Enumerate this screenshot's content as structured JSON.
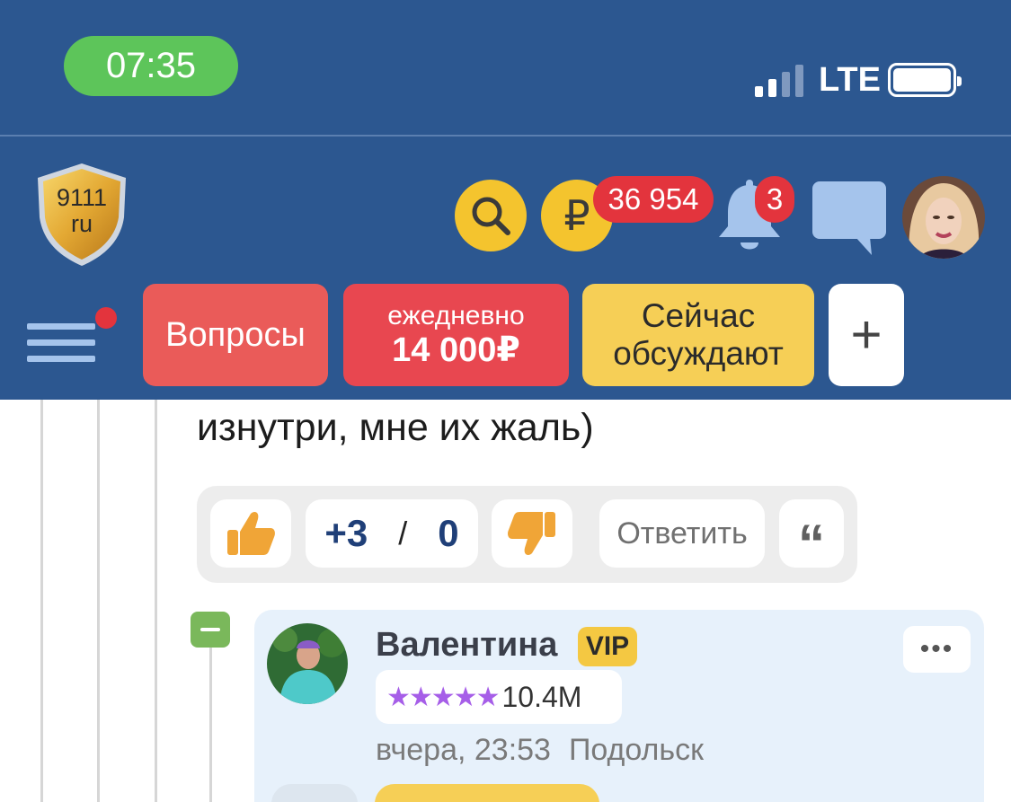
{
  "status_bar": {
    "time": "07:35",
    "network": "LTE",
    "colors": {
      "background": "#2c5790",
      "time_pill": "#5dc55a"
    }
  },
  "header": {
    "logo": {
      "line1": "9111",
      "line2": "ru"
    },
    "balance": "36 954",
    "notifications_count": "3",
    "ruble_symbol": "₽",
    "icons": [
      "search-icon",
      "ruble-icon",
      "bell-icon",
      "chat-icon",
      "user-avatar"
    ],
    "colors": {
      "background": "#2c5790",
      "accent_yellow": "#f4c42e",
      "badge_red": "#e3343d"
    }
  },
  "nav": {
    "questions_label": "Вопросы",
    "daily_line1": "ежедневно",
    "daily_line2": "14 000₽",
    "hot_line1": "Сейчас",
    "hot_line2": "обсуждают",
    "plus_label": "+",
    "menu_has_dot": true
  },
  "comment": {
    "text": "изнутри, мне их жаль)",
    "likes": "+3",
    "separator": "/",
    "dislikes": "0",
    "reply_label": "Ответить",
    "quote_symbol": "“"
  },
  "reply": {
    "author": "Валентина",
    "badge": "VIP",
    "stars": "★★★★★",
    "rating": "10.4M",
    "time": "вчера, 23:53",
    "city": "Подольск",
    "more_label": "•••"
  }
}
